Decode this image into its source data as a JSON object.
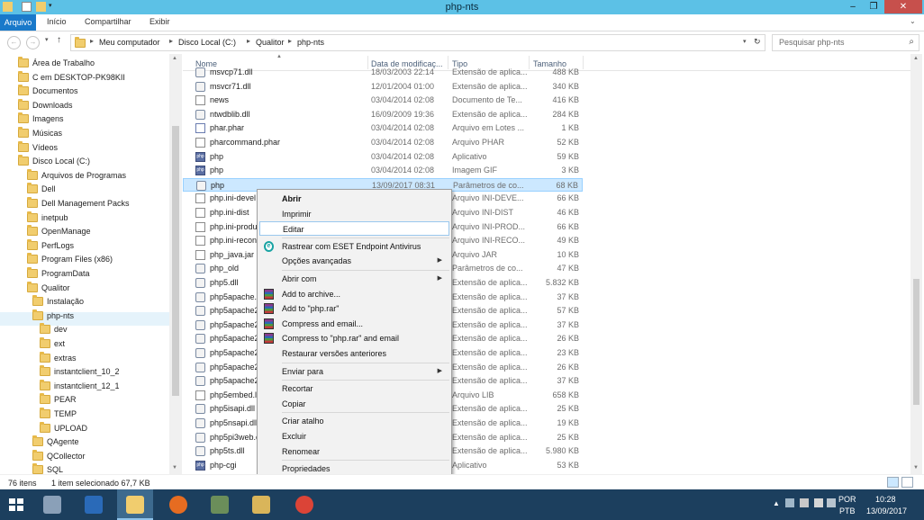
{
  "window": {
    "title": "php-nts",
    "btn_min": "–",
    "btn_max": "❐",
    "btn_close": "✕"
  },
  "ribbon": {
    "tabs": [
      "Arquivo",
      "Início",
      "Compartilhar",
      "Exibir"
    ]
  },
  "address": {
    "crumbs": [
      "Meu computador",
      "Disco Local (C:)",
      "Qualitor",
      "php-nts"
    ],
    "search_placeholder": "Pesquisar php-nts",
    "refresh": "↻"
  },
  "tree": {
    "items": [
      {
        "label": "Área de Trabalho",
        "indent": 0
      },
      {
        "label": "C em DESKTOP-PK98KII",
        "indent": 0
      },
      {
        "label": "Documentos",
        "indent": 0
      },
      {
        "label": "Downloads",
        "indent": 0
      },
      {
        "label": "Imagens",
        "indent": 0
      },
      {
        "label": "Músicas",
        "indent": 0
      },
      {
        "label": "Vídeos",
        "indent": 0
      },
      {
        "label": "Disco Local (C:)",
        "indent": 0
      },
      {
        "label": "Arquivos de Programas",
        "indent": 1
      },
      {
        "label": "Dell",
        "indent": 1
      },
      {
        "label": "Dell Management Packs",
        "indent": 1
      },
      {
        "label": "inetpub",
        "indent": 1
      },
      {
        "label": "OpenManage",
        "indent": 1
      },
      {
        "label": "PerfLogs",
        "indent": 1
      },
      {
        "label": "Program Files (x86)",
        "indent": 1
      },
      {
        "label": "ProgramData",
        "indent": 1
      },
      {
        "label": "Qualitor",
        "indent": 1
      },
      {
        "label": "Instalação",
        "indent": 2
      },
      {
        "label": "php-nts",
        "indent": 2
      },
      {
        "label": "dev",
        "indent": 3
      },
      {
        "label": "ext",
        "indent": 3
      },
      {
        "label": "extras",
        "indent": 3
      },
      {
        "label": "instantclient_10_2",
        "indent": 3
      },
      {
        "label": "instantclient_12_1",
        "indent": 3
      },
      {
        "label": "PEAR",
        "indent": 3
      },
      {
        "label": "TEMP",
        "indent": 3
      },
      {
        "label": "UPLOAD",
        "indent": 3
      },
      {
        "label": "QAgente",
        "indent": 2
      },
      {
        "label": "QCollector",
        "indent": 2
      },
      {
        "label": "SQL",
        "indent": 2
      }
    ]
  },
  "columns": {
    "name": "Nome",
    "date": "Data de modificaç...",
    "type": "Tipo",
    "size": "Tamanho"
  },
  "files": [
    {
      "name": "msvcp71.dll",
      "date": "18/03/2003 22:14",
      "type": "Extensão de aplica...",
      "size": "488 KB",
      "icon": "gear"
    },
    {
      "name": "msvcr71.dll",
      "date": "12/01/2004 01:00",
      "type": "Extensão de aplica...",
      "size": "340 KB",
      "icon": "gear"
    },
    {
      "name": "news",
      "date": "03/04/2014 02:08",
      "type": "Documento de Te...",
      "size": "416 KB",
      "icon": "file"
    },
    {
      "name": "ntwdblib.dll",
      "date": "16/09/2009 19:36",
      "type": "Extensão de aplica...",
      "size": "284 KB",
      "icon": "gear"
    },
    {
      "name": "phar.phar",
      "date": "03/04/2014 02:08",
      "type": "Arquivo em Lotes ...",
      "size": "1 KB",
      "icon": "phar"
    },
    {
      "name": "pharcommand.phar",
      "date": "03/04/2014 02:08",
      "type": "Arquivo PHAR",
      "size": "52 KB",
      "icon": "file"
    },
    {
      "name": "php",
      "date": "03/04/2014 02:08",
      "type": "Aplicativo",
      "size": "59 KB",
      "icon": "php"
    },
    {
      "name": "php",
      "date": "03/04/2014 02:08",
      "type": "Imagem GIF",
      "size": "3 KB",
      "icon": "php"
    },
    {
      "name": "php",
      "date": "13/09/2017 08:31",
      "type": "Parâmetros de co...",
      "size": "68 KB",
      "icon": "gear"
    },
    {
      "name": "php.ini-devel",
      "date": "",
      "type": "Arquivo INI-DEVE...",
      "size": "66 KB",
      "icon": "file"
    },
    {
      "name": "php.ini-dist",
      "date": "",
      "type": "Arquivo INI-DIST",
      "size": "46 KB",
      "icon": "file"
    },
    {
      "name": "php.ini-produ",
      "date": "",
      "type": "Arquivo INI-PROD...",
      "size": "66 KB",
      "icon": "file"
    },
    {
      "name": "php.ini-recon",
      "date": "",
      "type": "Arquivo INI-RECO...",
      "size": "49 KB",
      "icon": "file"
    },
    {
      "name": "php_java.jar",
      "date": "",
      "type": "Arquivo JAR",
      "size": "10 KB",
      "icon": "file"
    },
    {
      "name": "php_old",
      "date": "",
      "type": "Parâmetros de co...",
      "size": "47 KB",
      "icon": "gear"
    },
    {
      "name": "php5.dll",
      "date": "",
      "type": "Extensão de aplica...",
      "size": "5.832 KB",
      "icon": "gear"
    },
    {
      "name": "php5apache.d",
      "date": "",
      "type": "Extensão de aplica...",
      "size": "37 KB",
      "icon": "gear"
    },
    {
      "name": "php5apache2",
      "date": "",
      "type": "Extensão de aplica...",
      "size": "57 KB",
      "icon": "gear"
    },
    {
      "name": "php5apache2",
      "date": "",
      "type": "Extensão de aplica...",
      "size": "37 KB",
      "icon": "gear"
    },
    {
      "name": "php5apache2",
      "date": "",
      "type": "Extensão de aplica...",
      "size": "26 KB",
      "icon": "gear"
    },
    {
      "name": "php5apache2",
      "date": "",
      "type": "Extensão de aplica...",
      "size": "23 KB",
      "icon": "gear"
    },
    {
      "name": "php5apache2",
      "date": "",
      "type": "Extensão de aplica...",
      "size": "26 KB",
      "icon": "gear"
    },
    {
      "name": "php5apache2",
      "date": "",
      "type": "Extensão de aplica...",
      "size": "37 KB",
      "icon": "gear"
    },
    {
      "name": "php5embed.l",
      "date": "",
      "type": "Arquivo LIB",
      "size": "658 KB",
      "icon": "file"
    },
    {
      "name": "php5isapi.dll",
      "date": "",
      "type": "Extensão de aplica...",
      "size": "25 KB",
      "icon": "gear"
    },
    {
      "name": "php5nsapi.dll",
      "date": "",
      "type": "Extensão de aplica...",
      "size": "19 KB",
      "icon": "gear"
    },
    {
      "name": "php5pi3web.c",
      "date": "",
      "type": "Extensão de aplica...",
      "size": "25 KB",
      "icon": "gear"
    },
    {
      "name": "php5ts.dll",
      "date": "",
      "type": "Extensão de aplica...",
      "size": "5.980 KB",
      "icon": "gear"
    },
    {
      "name": "php-cgi",
      "date": "",
      "type": "Aplicativo",
      "size": "53 KB",
      "icon": "php"
    }
  ],
  "context_menu": [
    {
      "label": "Abrir",
      "bold": true
    },
    {
      "label": "Imprimir"
    },
    {
      "label": "Editar",
      "highlight": true
    },
    {
      "sep": true
    },
    {
      "label": "Rastrear com ESET Endpoint Antivirus",
      "icon": "eset"
    },
    {
      "label": "Opções avançadas",
      "submenu": true
    },
    {
      "sep": true
    },
    {
      "label": "Abrir com",
      "submenu": true
    },
    {
      "label": "Add to archive...",
      "icon": "rar"
    },
    {
      "label": "Add to \"php.rar\"",
      "icon": "rar"
    },
    {
      "label": "Compress and email...",
      "icon": "rar"
    },
    {
      "label": "Compress to \"php.rar\" and email",
      "icon": "rar"
    },
    {
      "label": "Restaurar versões anteriores"
    },
    {
      "sep": true
    },
    {
      "label": "Enviar para",
      "submenu": true
    },
    {
      "sep": true
    },
    {
      "label": "Recortar"
    },
    {
      "label": "Copiar"
    },
    {
      "sep": true
    },
    {
      "label": "Criar atalho"
    },
    {
      "label": "Excluir"
    },
    {
      "label": "Renomear"
    },
    {
      "sep": true
    },
    {
      "label": "Propriedades"
    }
  ],
  "status": {
    "count": "76 itens",
    "selected": "1 item selecionado 67,7 KB"
  },
  "taskbar": {
    "lang": "POR",
    "layout": "PTB",
    "time": "10:28",
    "date": "13/09/2017"
  }
}
